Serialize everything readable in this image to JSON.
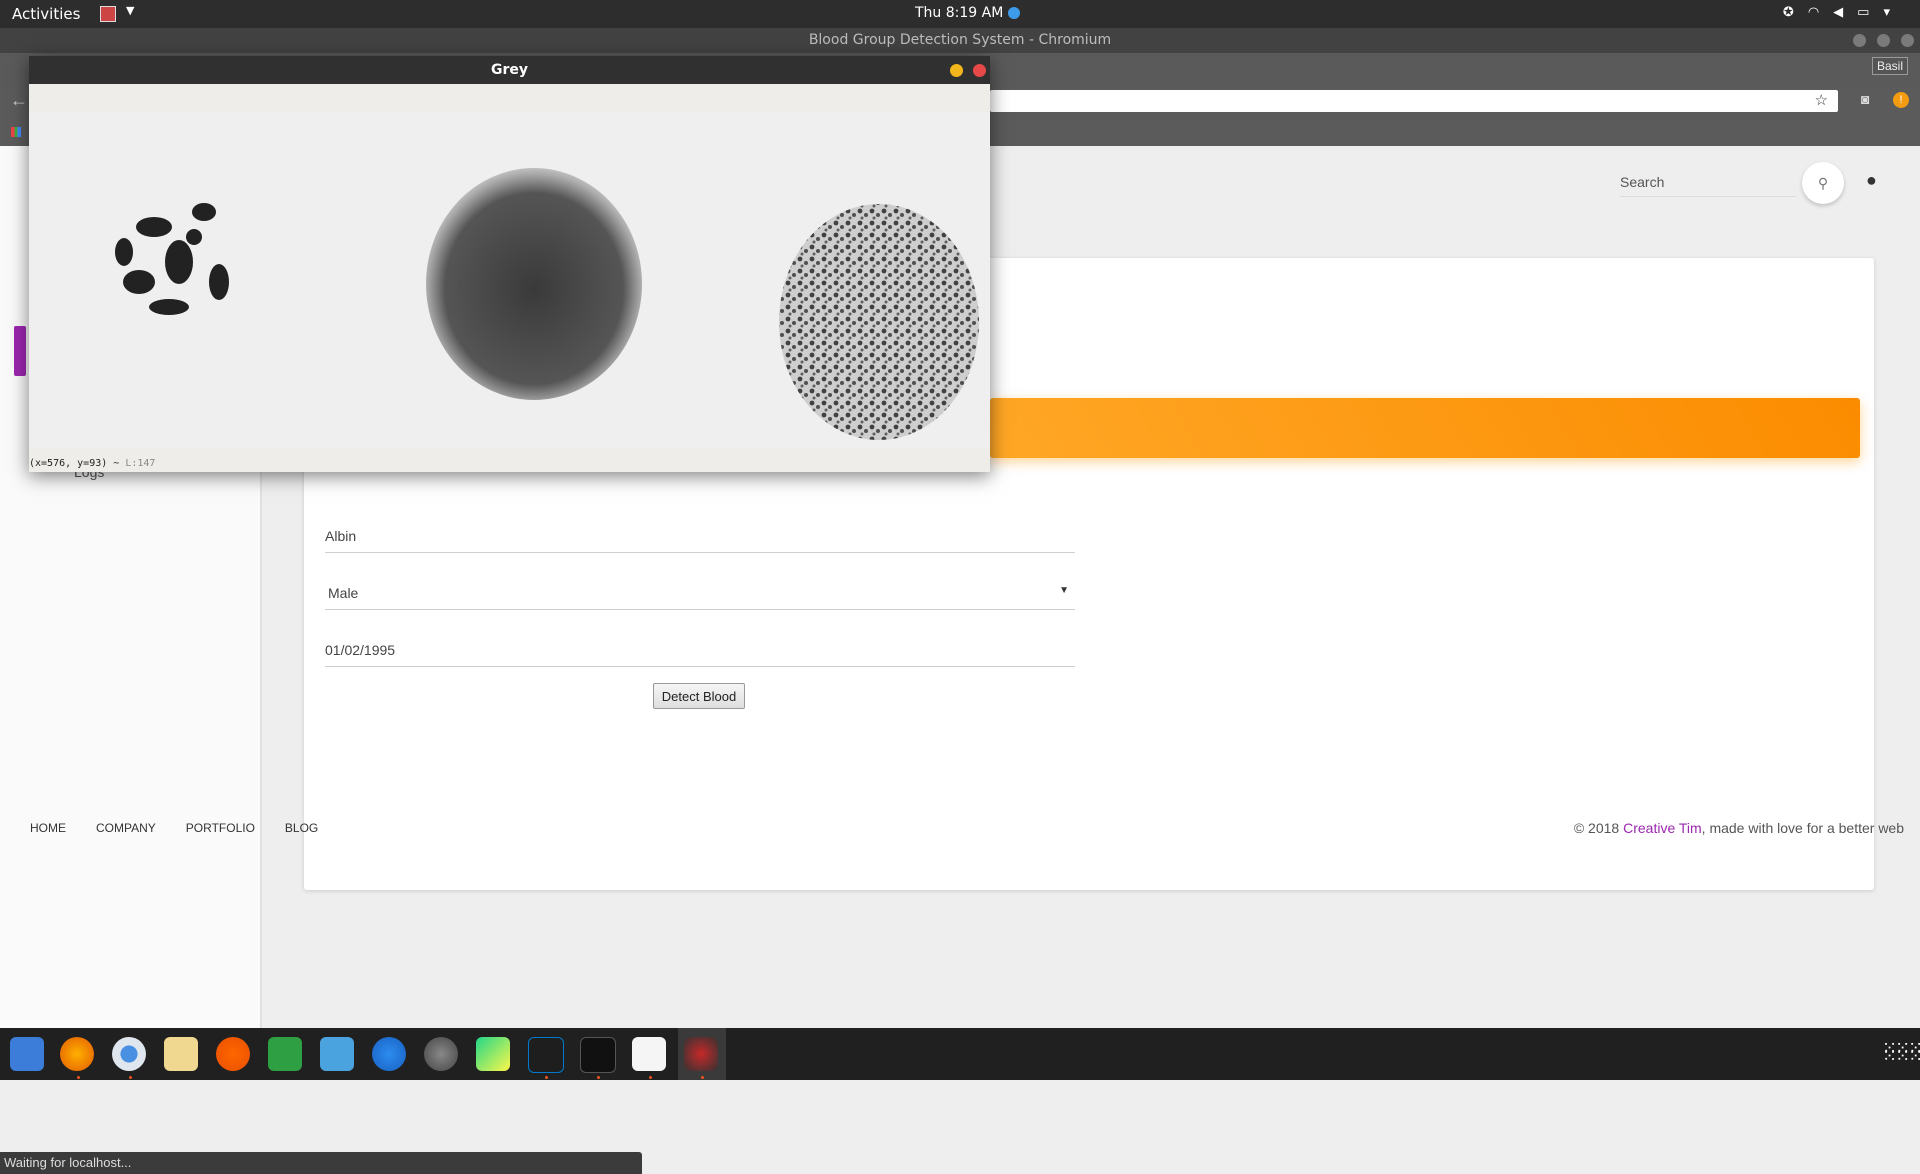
{
  "topbar": {
    "activities": "Activities",
    "clock": "Thu  8:19 AM",
    "tray_icons": [
      "accessibility-icon",
      "wifi-icon",
      "volume-icon",
      "battery-icon",
      "power-caret-icon"
    ]
  },
  "chromium": {
    "window_title": "Blood Group Detection System - Chromium",
    "profile": "Basil"
  },
  "page": {
    "search_placeholder": "Search",
    "sidebar_logs": "Logs",
    "form": {
      "name": "Albin",
      "gender": "Male",
      "dob": "01/02/1995",
      "detect_button": "Detect Blood"
    },
    "footer": {
      "nav": [
        "HOME",
        "COMPANY",
        "PORTFOLIO",
        "BLOG"
      ],
      "copyright_prefix": "© 2018 ",
      "brand": "Creative Tim",
      "copyright_suffix": ", made with love for a better web"
    },
    "colors": {
      "accent_orange": "#ff9800",
      "accent_purple": "#9c27b0"
    }
  },
  "status_text": "Waiting for localhost...",
  "cv_window": {
    "title": "Grey",
    "coord_status": "(x=576, y=93) ~ ",
    "luminance": "L:147"
  },
  "dock": {
    "apps": [
      "finder-icon",
      "firefox-icon",
      "chromium-icon",
      "text-editor-icon",
      "vlc-icon",
      "spreadsheet-icon",
      "image-viewer-icon",
      "app-store-icon",
      "settings-icon",
      "pycharm-icon",
      "vscode-icon",
      "terminal-icon",
      "notes-icon",
      "screen-recorder-icon"
    ],
    "show_apps": "show-applications-icon"
  }
}
